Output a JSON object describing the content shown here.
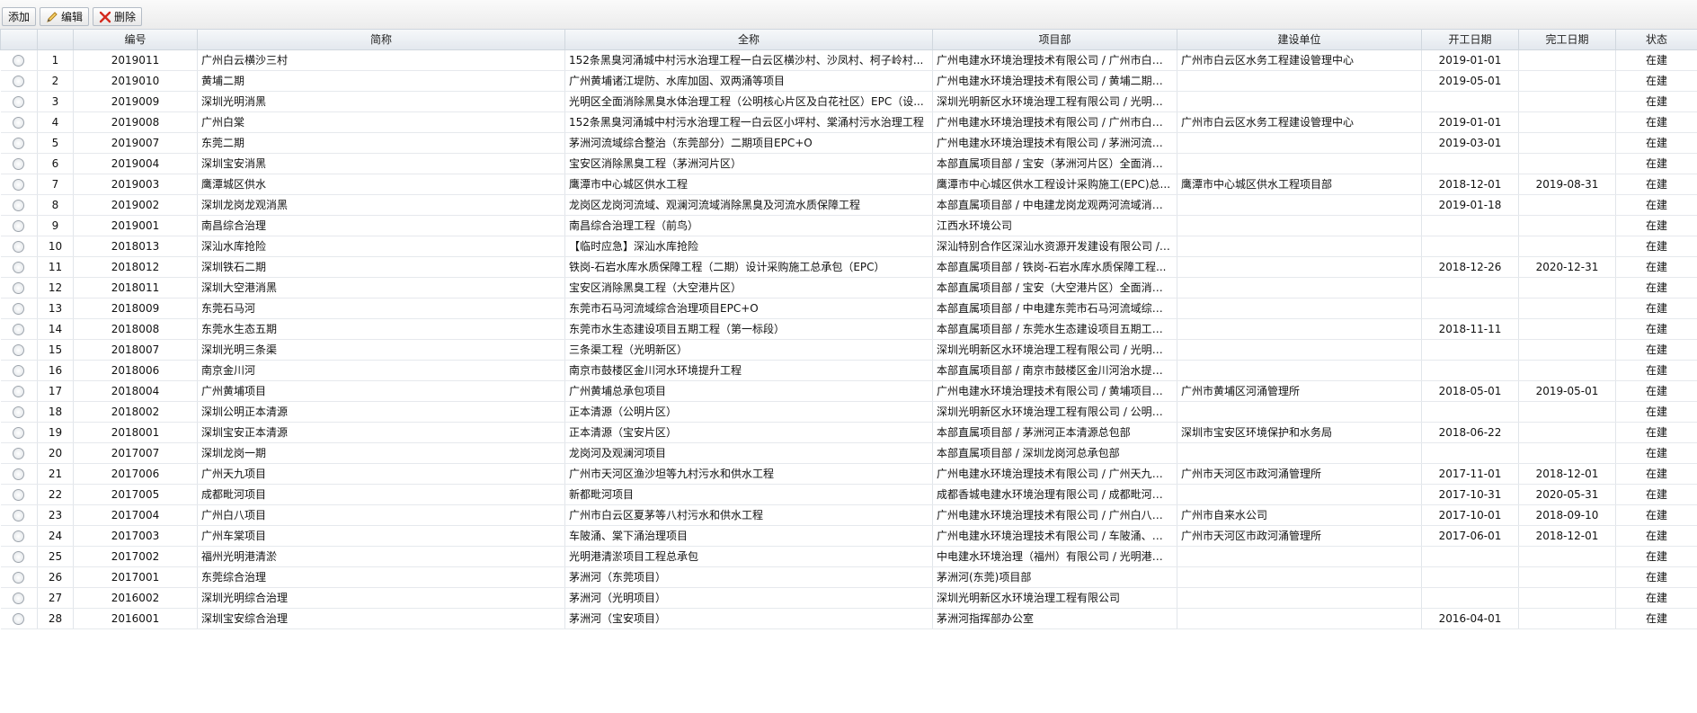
{
  "toolbar": {
    "add_label": "添加",
    "edit_label": "编辑",
    "delete_label": "删除",
    "edit_icon": "pencil-icon",
    "delete_icon": "red-x-icon"
  },
  "columns": [
    "",
    "",
    "编号",
    "简称",
    "全称",
    "项目部",
    "建设单位",
    "开工日期",
    "完工日期",
    "状态"
  ],
  "rows": [
    {
      "n": "1",
      "code": "2019011",
      "short": "广州白云横沙三村",
      "full": "152条黑臭河涌城中村污水治理工程一白云区横沙村、沙凤村、柯子岭村...",
      "dept": "广州电建水环境治理技术有限公司 / 广州市白云...",
      "unit": "广州市白云区水务工程建设管理中心",
      "start": "2019-01-01",
      "end": "",
      "status": "在建"
    },
    {
      "n": "2",
      "code": "2019010",
      "short": "黄埔二期",
      "full": "广州黄埔诸江堤防、水库加固、双两涌等项目",
      "dept": "广州电建水环境治理技术有限公司 / 黄埔二期项...",
      "unit": "",
      "start": "2019-05-01",
      "end": "",
      "status": "在建"
    },
    {
      "n": "3",
      "code": "2019009",
      "short": "深圳光明消黑",
      "full": "光明区全面消除黑臭水体治理工程（公明核心片区及白花社区）EPC（设...",
      "dept": "深圳光明新区水环境治理工程有限公司 / 光明区...",
      "unit": "",
      "start": "",
      "end": "",
      "status": "在建"
    },
    {
      "n": "4",
      "code": "2019008",
      "short": "广州白棠",
      "full": "152条黑臭河涌城中村污水治理工程一白云区小坪村、棠涌村污水治理工程",
      "dept": "广州电建水环境治理技术有限公司 / 广州市白云...",
      "unit": "广州市白云区水务工程建设管理中心",
      "start": "2019-01-01",
      "end": "",
      "status": "在建"
    },
    {
      "n": "5",
      "code": "2019007",
      "short": "东莞二期",
      "full": "茅洲河流域综合整治（东莞部分）二期项目EPC+O",
      "dept": "广州电建水环境治理技术有限公司 / 茅洲河流域...",
      "unit": "",
      "start": "2019-03-01",
      "end": "",
      "status": "在建"
    },
    {
      "n": "6",
      "code": "2019004",
      "short": "深圳宝安消黑",
      "full": "宝安区消除黑臭工程（茅洲河片区）",
      "dept": "本部直属项目部 / 宝安（茅洲河片区）全面消黑...",
      "unit": "",
      "start": "",
      "end": "",
      "status": "在建"
    },
    {
      "n": "7",
      "code": "2019003",
      "short": "鹰潭城区供水",
      "full": "鹰潭市中心城区供水工程",
      "dept": "鹰潭市中心城区供水工程设计采购施工(EPC)总...",
      "unit": "鹰潭市中心城区供水工程项目部",
      "start": "2018-12-01",
      "end": "2019-08-31",
      "status": "在建"
    },
    {
      "n": "8",
      "code": "2019002",
      "short": "深圳龙岗龙观消黑",
      "full": "龙岗区龙岗河流域、观澜河流域消除黑臭及河流水质保障工程",
      "dept": "本部直属项目部 / 中电建龙岗龙观两河流域消黑...",
      "unit": "",
      "start": "2019-01-18",
      "end": "",
      "status": "在建"
    },
    {
      "n": "9",
      "code": "2019001",
      "short": "南昌综合治理",
      "full": "南昌综合治理工程（前鸟）",
      "dept": "江西水环境公司",
      "unit": "",
      "start": "",
      "end": "",
      "status": "在建"
    },
    {
      "n": "10",
      "code": "2018013",
      "short": "深汕水库抢险",
      "full": "【临时应急】深汕水库抢险",
      "dept": "深汕特别合作区深汕水资源开发建设有限公司 / ...",
      "unit": "",
      "start": "",
      "end": "",
      "status": "在建"
    },
    {
      "n": "11",
      "code": "2018012",
      "short": "深圳铁石二期",
      "full": "铁岗-石岩水库水质保障工程（二期）设计采购施工总承包（EPC）",
      "dept": "本部直属项目部 / 铁岗-石岩水库水质保障工程...",
      "unit": "",
      "start": "2018-12-26",
      "end": "2020-12-31",
      "status": "在建"
    },
    {
      "n": "12",
      "code": "2018011",
      "short": "深圳大空港消黑",
      "full": "宝安区消除黑臭工程（大空港片区）",
      "dept": "本部直属项目部 / 宝安（大空港片区）全面消黑...",
      "unit": "",
      "start": "",
      "end": "",
      "status": "在建"
    },
    {
      "n": "13",
      "code": "2018009",
      "short": "东莞石马河",
      "full": "东莞市石马河流域综合治理项目EPC+O",
      "dept": "本部直属项目部 / 中电建东莞市石马河流域综合...",
      "unit": "",
      "start": "",
      "end": "",
      "status": "在建"
    },
    {
      "n": "14",
      "code": "2018008",
      "short": "东莞水生态五期",
      "full": "东莞市水生态建设项目五期工程（第一标段）",
      "dept": "本部直属项目部 / 东莞水生态建设项目五期工程...",
      "unit": "",
      "start": "2018-11-11",
      "end": "",
      "status": "在建"
    },
    {
      "n": "15",
      "code": "2018007",
      "short": "深圳光明三条渠",
      "full": "三条渠工程（光明新区）",
      "dept": "深圳光明新区水环境治理工程有限公司 / 光明三...",
      "unit": "",
      "start": "",
      "end": "",
      "status": "在建"
    },
    {
      "n": "16",
      "code": "2018006",
      "short": "南京金川河",
      "full": "南京市鼓楼区金川河水环境提升工程",
      "dept": "本部直属项目部 / 南京市鼓楼区金川河治水提质...",
      "unit": "",
      "start": "",
      "end": "",
      "status": "在建"
    },
    {
      "n": "17",
      "code": "2018004",
      "short": "广州黄埔项目",
      "full": "广州黄埔总承包项目",
      "dept": "广州电建水环境治理技术有限公司 / 黄埔项目总...",
      "unit": "广州市黄埔区河涌管理所",
      "start": "2018-05-01",
      "end": "2019-05-01",
      "status": "在建"
    },
    {
      "n": "18",
      "code": "2018002",
      "short": "深圳公明正本清源",
      "full": "正本清源（公明片区）",
      "dept": "深圳光明新区水环境治理工程有限公司 / 公明正...",
      "unit": "",
      "start": "",
      "end": "",
      "status": "在建"
    },
    {
      "n": "19",
      "code": "2018001",
      "short": "深圳宝安正本清源",
      "full": "正本清源（宝安片区）",
      "dept": "本部直属项目部 / 茅洲河正本清源总包部",
      "unit": "深圳市宝安区环境保护和水务局",
      "start": "2018-06-22",
      "end": "",
      "status": "在建"
    },
    {
      "n": "20",
      "code": "2017007",
      "short": "深圳龙岗一期",
      "full": "龙岗河及观澜河项目",
      "dept": "本部直属项目部 / 深圳龙岗河总承包部",
      "unit": "",
      "start": "",
      "end": "",
      "status": "在建"
    },
    {
      "n": "21",
      "code": "2017006",
      "short": "广州天九项目",
      "full": "广州市天河区渔沙坦等九村污水和供水工程",
      "dept": "广州电建水环境治理技术有限公司 / 广州天九总...",
      "unit": "广州市天河区市政河涌管理所",
      "start": "2017-11-01",
      "end": "2018-12-01",
      "status": "在建"
    },
    {
      "n": "22",
      "code": "2017005",
      "short": "成都毗河项目",
      "full": "新都毗河项目",
      "dept": "成都香城电建水环境治理有限公司 / 成都毗河总...",
      "unit": "",
      "start": "2017-10-31",
      "end": "2020-05-31",
      "status": "在建"
    },
    {
      "n": "23",
      "code": "2017004",
      "short": "广州白八项目",
      "full": "广州市白云区夏茅等八村污水和供水工程",
      "dept": "广州电建水环境治理技术有限公司 / 广州白八总...",
      "unit": "广州市自来水公司",
      "start": "2017-10-01",
      "end": "2018-09-10",
      "status": "在建"
    },
    {
      "n": "24",
      "code": "2017003",
      "short": "广州车棠项目",
      "full": "车陂涌、棠下涌治理项目",
      "dept": "广州电建水环境治理技术有限公司 / 车陂涌、棠...",
      "unit": "广州市天河区市政河涌管理所",
      "start": "2017-06-01",
      "end": "2018-12-01",
      "status": "在建"
    },
    {
      "n": "25",
      "code": "2017002",
      "short": "福州光明港清淤",
      "full": "光明港清淤项目工程总承包",
      "dept": "中电建水环境治理（福州）有限公司 / 光明港清...",
      "unit": "",
      "start": "",
      "end": "",
      "status": "在建"
    },
    {
      "n": "26",
      "code": "2017001",
      "short": "东莞综合治理",
      "full": "茅洲河（东莞项目）",
      "dept": "茅洲河(东莞)项目部",
      "unit": "",
      "start": "",
      "end": "",
      "status": "在建"
    },
    {
      "n": "27",
      "code": "2016002",
      "short": "深圳光明综合治理",
      "full": "茅洲河（光明项目）",
      "dept": "深圳光明新区水环境治理工程有限公司",
      "unit": "",
      "start": "",
      "end": "",
      "status": "在建"
    },
    {
      "n": "28",
      "code": "2016001",
      "short": "深圳宝安综合治理",
      "full": "茅洲河（宝安项目）",
      "dept": "茅洲河指挥部办公室",
      "unit": "",
      "start": "2016-04-01",
      "end": "",
      "status": "在建"
    }
  ]
}
